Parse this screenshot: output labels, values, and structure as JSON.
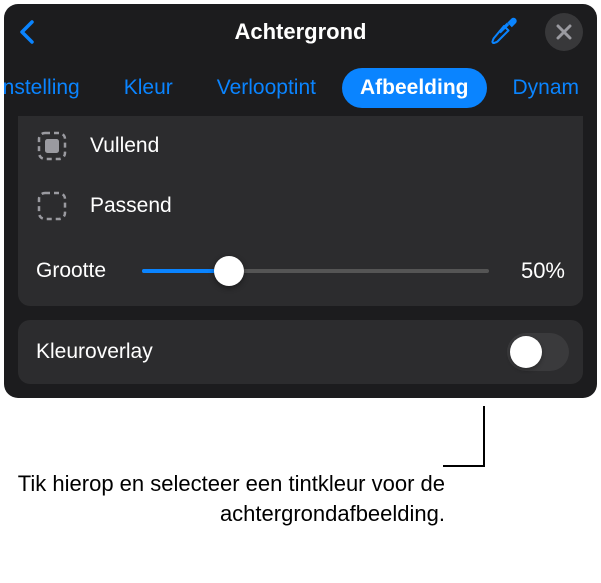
{
  "header": {
    "title": "Achtergrond"
  },
  "tabs": {
    "items": [
      {
        "label": "instelling"
      },
      {
        "label": "Kleur"
      },
      {
        "label": "Verlooptint"
      },
      {
        "label": "Afbeelding"
      },
      {
        "label": "Dynam"
      }
    ],
    "active_index": 3
  },
  "fill_options": {
    "fill": "Vullend",
    "fit": "Passend"
  },
  "size": {
    "label": "Grootte",
    "value_text": "50%",
    "percent": 50
  },
  "color_overlay": {
    "label": "Kleuroverlay",
    "on": false
  },
  "callout": {
    "text": "Tik hierop en selecteer een tintkleur voor de achtergrondafbeelding."
  },
  "colors": {
    "accent": "#0a84ff",
    "panel_bg": "#1c1c1e",
    "section_bg": "#2c2c2e"
  }
}
